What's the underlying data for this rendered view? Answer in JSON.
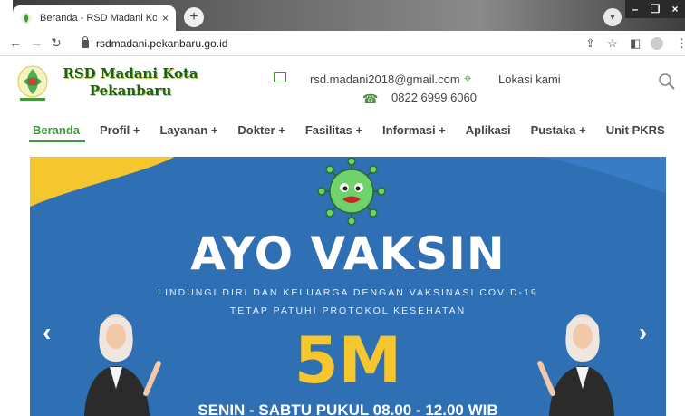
{
  "browser": {
    "tab_title": "Beranda - RSD Madani Kota Peka",
    "tab_close": "×",
    "new_tab": "+",
    "url": "rsdmadani.pekanbaru.go.id",
    "win_min": "–",
    "win_max": "❐",
    "win_close": "×"
  },
  "site": {
    "brand_line1": "RSD Madani Kota",
    "brand_line2": "Pekanbaru",
    "email": "rsd.madani2018@gmail.com",
    "phone": "0822 6999 6060",
    "location": "Lokasi kami"
  },
  "menu": [
    {
      "label": "Beranda",
      "active": true
    },
    {
      "label": "Profil  +"
    },
    {
      "label": "Layanan  +"
    },
    {
      "label": "Dokter  +"
    },
    {
      "label": "Fasilitas  +"
    },
    {
      "label": "Informasi  +"
    },
    {
      "label": "Aplikasi"
    },
    {
      "label": "Pustaka  +"
    },
    {
      "label": "Unit PKRS"
    }
  ],
  "banner": {
    "headline": "AYO VAKSIN",
    "sub1": "LINDUNGI DIRI DAN KELUARGA DENGAN VAKSINASI COVID-19",
    "sub2": "TETAP PATUHI PROTOKOL KESEHATAN",
    "big": "5M",
    "bottom": "SENIN - SABTU PUKUL 08.00 - 12.00 WIB",
    "prev": "‹",
    "next": "›"
  },
  "colors": {
    "brand_green": "#3e9b3a",
    "banner_blue": "#2f6fb3",
    "accent_yellow": "#f6c62f"
  }
}
